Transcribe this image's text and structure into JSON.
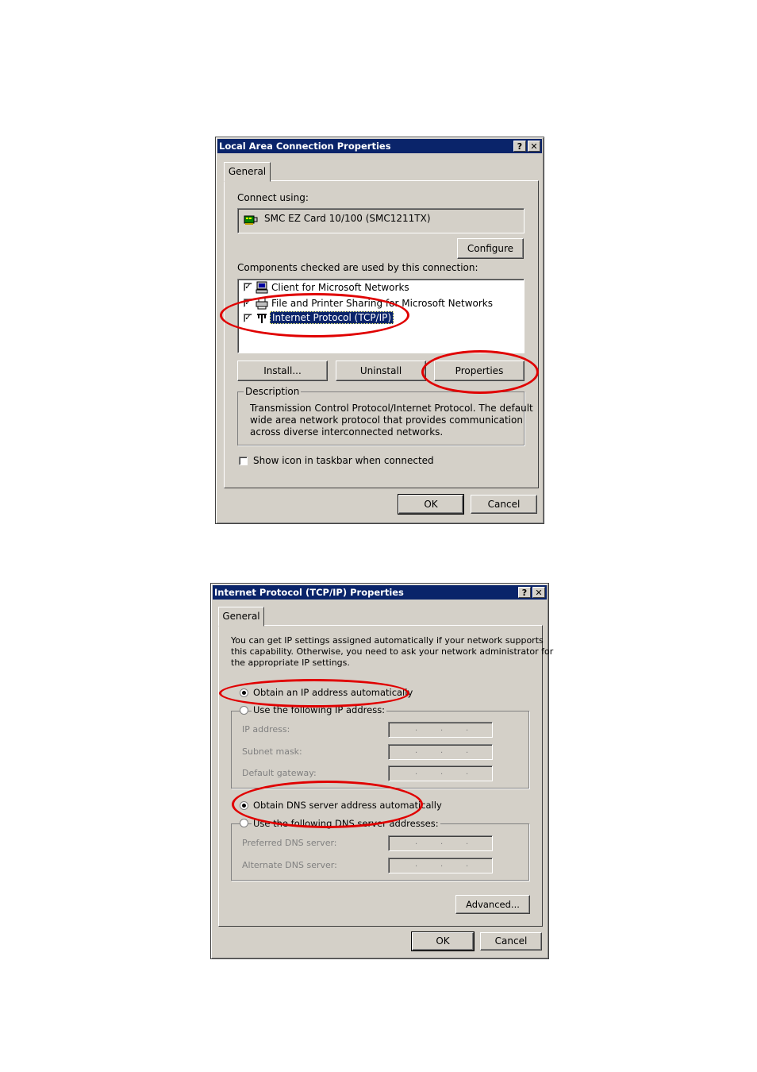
{
  "dialog1": {
    "title": "Local Area Connection Properties",
    "help_btn": "?",
    "close_btn": "✕",
    "tab": "General",
    "connect_using_label": "Connect using:",
    "adapter": "SMC EZ Card 10/100 (SMC1211TX)",
    "configure_btn": "Configure",
    "components_label": "Components checked are used by this connection:",
    "components": [
      {
        "label": "Client for Microsoft Networks",
        "checked": true
      },
      {
        "label": "File and Printer Sharing for Microsoft Networks",
        "checked": true
      },
      {
        "label": "Internet Protocol (TCP/IP)",
        "checked": true,
        "selected": true
      }
    ],
    "install_btn": "Install...",
    "uninstall_btn": "Uninstall",
    "properties_btn": "Properties",
    "description_label": "Description",
    "description_text_1": "Transmission Control Protocol/Internet Protocol. The default",
    "description_text_2": "wide area network protocol that provides communication",
    "description_text_3": "across diverse interconnected networks.",
    "show_icon_label": "Show icon in taskbar when connected",
    "ok_btn": "OK",
    "cancel_btn": "Cancel"
  },
  "dialog2": {
    "title": "Internet Protocol (TCP/IP) Properties",
    "help_btn": "?",
    "close_btn": "✕",
    "tab": "General",
    "intro_1": "You can get IP settings assigned automatically if your network supports",
    "intro_2": "this capability. Otherwise, you need to ask your network administrator for",
    "intro_3": "the appropriate IP settings.",
    "obtain_ip_auto": "Obtain an IP address automatically",
    "use_following_ip": "Use the following IP address:",
    "ip_address_label": "IP address:",
    "subnet_mask_label": "Subnet mask:",
    "default_gateway_label": "Default gateway:",
    "obtain_dns_auto": "Obtain DNS server address automatically",
    "use_following_dns": "Use the following DNS server addresses:",
    "preferred_dns_label": "Preferred DNS server:",
    "alternate_dns_label": "Alternate DNS server:",
    "ip_dot": ".",
    "advanced_btn": "Advanced...",
    "ok_btn": "OK",
    "cancel_btn": "Cancel"
  },
  "colors": {
    "titlebar": "#0a246a",
    "face": "#d4d0c8",
    "highlight_circle": "#e00000"
  }
}
